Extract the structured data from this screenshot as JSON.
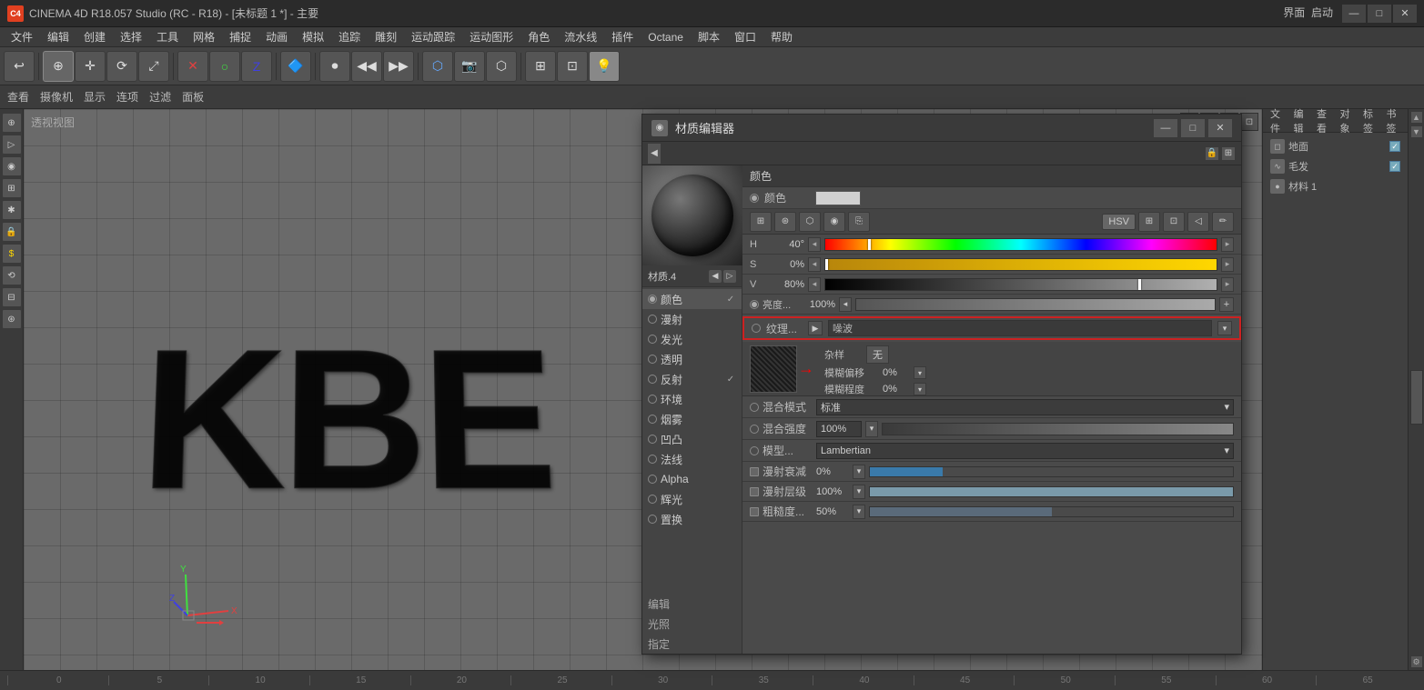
{
  "window": {
    "title": "CINEMA 4D R18.057 Studio (RC - R18) - [未标题 1 *] - 主要",
    "mode_label": "界面",
    "layout_label": "启动"
  },
  "menubar": {
    "items": [
      "文件",
      "编辑",
      "创建",
      "选择",
      "工具",
      "网格",
      "捕捉",
      "动画",
      "模拟",
      "追踪",
      "雕刻",
      "运动跟踪",
      "运动图形",
      "角色",
      "流水线",
      "插件",
      "Octane",
      "脚本",
      "窗口",
      "帮助"
    ]
  },
  "sub_toolbar": {
    "items": [
      "查看",
      "摄像机",
      "显示",
      "连项",
      "过滤",
      "面板"
    ]
  },
  "viewport": {
    "label": "透视视图",
    "kbe_text": "KBE"
  },
  "ruler": {
    "marks": [
      "0",
      "5",
      "10",
      "15",
      "20",
      "25",
      "30",
      "35",
      "40",
      "45",
      "50",
      "55",
      "60",
      "65"
    ]
  },
  "right_panel": {
    "toolbar": [
      "文件",
      "编辑",
      "查看",
      "对象",
      "标签",
      "书签"
    ],
    "objects": [
      {
        "name": "地面",
        "icon": "◻",
        "has_check": true
      },
      {
        "name": "毛发",
        "icon": "∿",
        "has_check": true
      },
      {
        "name": "材料 1",
        "icon": "●",
        "has_check": false
      }
    ]
  },
  "material_editor": {
    "title": "材质编辑器",
    "mat_name": "材质.4",
    "section": "颜色",
    "color_label": "颜色",
    "color_swatch": "#d0d0d0",
    "hsv": {
      "h_label": "H",
      "h_value": "40°",
      "s_label": "S",
      "s_value": "0%",
      "v_label": "V",
      "v_value": "80%"
    },
    "brightness": {
      "label": "亮度...",
      "value": "100%"
    },
    "texture": {
      "label": "纹理...",
      "value": "噪波",
      "play_icon": "▶"
    },
    "noise": {
      "type_label": "杂样",
      "type_value": "无",
      "blur_label": "模糊偏移",
      "blur_value": "0%",
      "strength_label": "模糊程度",
      "strength_value": "0%"
    },
    "blend": {
      "mode_label": "混合模式",
      "mode_value": "标准",
      "strength_label": "混合强度",
      "strength_value": "100%"
    },
    "model": {
      "label": "模型...",
      "value": "Lambertian"
    },
    "diffuse": {
      "decay_label": "漫射衰减",
      "decay_value": "0%",
      "level_label": "漫射层级",
      "level_value": "100%",
      "rough_label": "粗糙度...",
      "rough_value": "50%"
    },
    "sections": {
      "edit": "编辑",
      "light": "光照",
      "assign": "指定"
    },
    "channels": [
      {
        "name": "颜色",
        "active": true,
        "checked": true
      },
      {
        "name": "漫射",
        "active": false,
        "checked": false
      },
      {
        "name": "发光",
        "active": false,
        "checked": false
      },
      {
        "name": "透明",
        "active": false,
        "checked": false
      },
      {
        "name": "反射",
        "active": false,
        "checked": true
      },
      {
        "name": "环境",
        "active": false,
        "checked": false
      },
      {
        "name": "烟雾",
        "active": false,
        "checked": false
      },
      {
        "name": "凹凸",
        "active": false,
        "checked": false
      },
      {
        "name": "法线",
        "active": false,
        "checked": false
      },
      {
        "name": "Alpha",
        "active": false,
        "checked": false
      },
      {
        "name": "辉光",
        "active": false,
        "checked": false
      },
      {
        "name": "置换",
        "active": false,
        "checked": false
      }
    ]
  },
  "icons": {
    "undo": "↩",
    "move": "✛",
    "rotate": "↻",
    "scale": "+",
    "x_axis": "X",
    "y_axis": "Y",
    "z_axis": "Z",
    "play": "▶",
    "stop": "■",
    "gear": "⚙",
    "arrow_left": "◀",
    "arrow_right": "▶",
    "arrow_up": "▲",
    "arrow_down": "▼",
    "minimize": "—",
    "maximize": "□",
    "close": "✕",
    "triangle_right": "▶",
    "triangle_down": "▼",
    "checkmark": "✓",
    "dropdown": "▾"
  }
}
